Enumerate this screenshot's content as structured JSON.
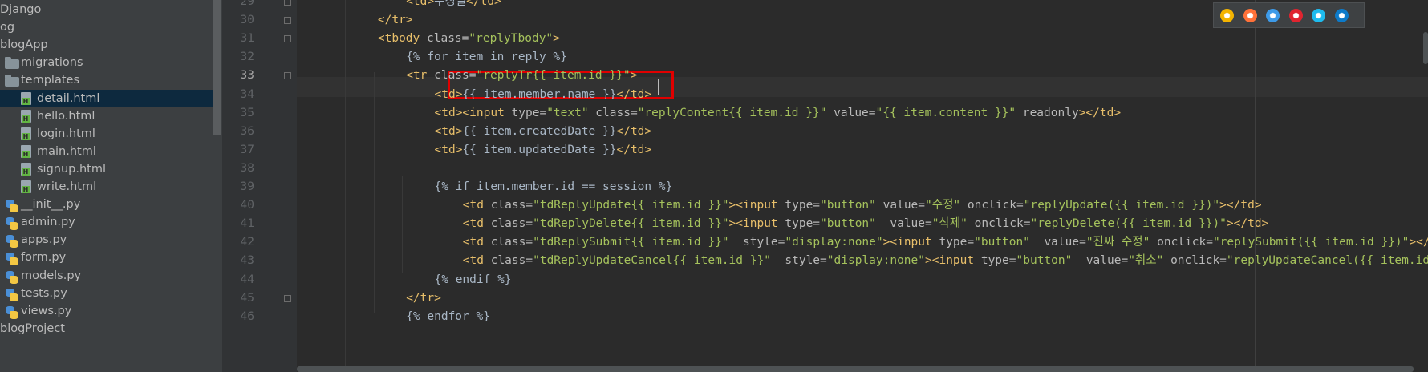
{
  "project_tree": {
    "items": [
      {
        "label": "Django",
        "icon": "folder-icon",
        "indent": 0
      },
      {
        "label": "og",
        "icon": "folder-icon",
        "indent": 0
      },
      {
        "label": "blogApp",
        "icon": "folder-icon",
        "indent": 0
      },
      {
        "label": "migrations",
        "icon": "folder-icon",
        "indent": 1
      },
      {
        "label": "templates",
        "icon": "folder-icon",
        "indent": 1
      },
      {
        "label": "detail.html",
        "icon": "html-file-icon",
        "indent": 2,
        "selected": true
      },
      {
        "label": "hello.html",
        "icon": "html-file-icon",
        "indent": 2
      },
      {
        "label": "login.html",
        "icon": "html-file-icon",
        "indent": 2
      },
      {
        "label": "main.html",
        "icon": "html-file-icon",
        "indent": 2
      },
      {
        "label": "signup.html",
        "icon": "html-file-icon",
        "indent": 2
      },
      {
        "label": "write.html",
        "icon": "html-file-icon",
        "indent": 2
      },
      {
        "label": "__init__.py",
        "icon": "python-file-icon",
        "indent": 1
      },
      {
        "label": "admin.py",
        "icon": "python-file-icon",
        "indent": 1
      },
      {
        "label": "apps.py",
        "icon": "python-file-icon",
        "indent": 1
      },
      {
        "label": "form.py",
        "icon": "python-file-icon",
        "indent": 1
      },
      {
        "label": "models.py",
        "icon": "python-file-icon",
        "indent": 1
      },
      {
        "label": "tests.py",
        "icon": "python-file-icon",
        "indent": 1
      },
      {
        "label": "views.py",
        "icon": "python-file-icon",
        "indent": 1
      },
      {
        "label": "blogProject",
        "icon": "folder-icon",
        "indent": 0
      }
    ]
  },
  "editor": {
    "current_line": "33",
    "lines": [
      {
        "no": "29",
        "indent": 4,
        "fold": true,
        "tokens": [
          [
            "t",
            "<td>"
          ],
          [
            "tp",
            "수정일"
          ],
          [
            "t",
            "</td>"
          ]
        ]
      },
      {
        "no": "30",
        "indent": 3,
        "fold": true,
        "tokens": [
          [
            "t",
            "</tr>"
          ]
        ]
      },
      {
        "no": "31",
        "indent": 3,
        "fold": true,
        "tokens": [
          [
            "t",
            "<tbody "
          ],
          [
            "a",
            "class="
          ],
          [
            "s",
            "\"replyTbody\""
          ],
          [
            "t",
            ">"
          ]
        ]
      },
      {
        "no": "32",
        "indent": 4,
        "fold": false,
        "tokens": [
          [
            "tp",
            "{% for item in reply %}"
          ]
        ]
      },
      {
        "no": "33",
        "indent": 4,
        "fold": true,
        "tokens": [
          [
            "t",
            "<tr "
          ],
          [
            "a",
            "class="
          ],
          [
            "s",
            "\"replyTr{{ item.id }}\""
          ],
          [
            "t",
            ">"
          ]
        ]
      },
      {
        "no": "34",
        "indent": 5,
        "fold": false,
        "tokens": [
          [
            "t",
            "<td>"
          ],
          [
            "tp",
            "{{ item.member.name }}"
          ],
          [
            "t",
            "</td>"
          ]
        ]
      },
      {
        "no": "35",
        "indent": 5,
        "fold": false,
        "tokens": [
          [
            "t",
            "<td><input "
          ],
          [
            "a",
            "type="
          ],
          [
            "s",
            "\"text\" "
          ],
          [
            "a",
            "class="
          ],
          [
            "s",
            "\"replyContent{{ item.id }}\" "
          ],
          [
            "a",
            "value="
          ],
          [
            "s",
            "\"{{ item.content }}\" "
          ],
          [
            "a",
            "readonly"
          ],
          [
            "t",
            "></td>"
          ]
        ]
      },
      {
        "no": "36",
        "indent": 5,
        "fold": false,
        "tokens": [
          [
            "t",
            "<td>"
          ],
          [
            "tp",
            "{{ item.createdDate }}"
          ],
          [
            "t",
            "</td>"
          ]
        ]
      },
      {
        "no": "37",
        "indent": 5,
        "fold": false,
        "tokens": [
          [
            "t",
            "<td>"
          ],
          [
            "tp",
            "{{ item.updatedDate }}"
          ],
          [
            "t",
            "</td>"
          ]
        ]
      },
      {
        "no": "38",
        "indent": 0,
        "fold": false,
        "tokens": []
      },
      {
        "no": "39",
        "indent": 5,
        "fold": false,
        "tokens": [
          [
            "tp",
            "{% if item.member.id == session %}"
          ]
        ]
      },
      {
        "no": "40",
        "indent": 6,
        "fold": false,
        "tokens": [
          [
            "t",
            "<td "
          ],
          [
            "a",
            "class="
          ],
          [
            "s",
            "\"tdReplyUpdate{{ item.id }}\""
          ],
          [
            "t",
            "><input "
          ],
          [
            "a",
            "type="
          ],
          [
            "s",
            "\"button\" "
          ],
          [
            "a",
            "value="
          ],
          [
            "s",
            "\"수정\" "
          ],
          [
            "a",
            "onclick="
          ],
          [
            "s",
            "\"replyUpdate({{ item.id }})\""
          ],
          [
            "t",
            "></td>"
          ]
        ]
      },
      {
        "no": "41",
        "indent": 6,
        "fold": false,
        "tokens": [
          [
            "t",
            "<td "
          ],
          [
            "a",
            "class="
          ],
          [
            "s",
            "\"tdReplyDelete{{ item.id }}\""
          ],
          [
            "t",
            "><input "
          ],
          [
            "a",
            "type="
          ],
          [
            "s",
            "\"button\"  "
          ],
          [
            "a",
            "value="
          ],
          [
            "s",
            "\"삭제\" "
          ],
          [
            "a",
            "onclick="
          ],
          [
            "s",
            "\"replyDelete({{ item.id }})\""
          ],
          [
            "t",
            "></td>"
          ]
        ]
      },
      {
        "no": "42",
        "indent": 6,
        "fold": false,
        "tokens": [
          [
            "t",
            "<td "
          ],
          [
            "a",
            "class="
          ],
          [
            "s",
            "\"tdReplySubmit{{ item.id }}\"  "
          ],
          [
            "a",
            "style="
          ],
          [
            "s",
            "\"display:none\""
          ],
          [
            "t",
            "><input "
          ],
          [
            "a",
            "type="
          ],
          [
            "s",
            "\"button\"  "
          ],
          [
            "a",
            "value="
          ],
          [
            "s",
            "\"진짜 수정\" "
          ],
          [
            "a",
            "onclick="
          ],
          [
            "s",
            "\"replySubmit({{ item.id }})\""
          ],
          [
            "t",
            "></td>"
          ]
        ]
      },
      {
        "no": "43",
        "indent": 6,
        "fold": false,
        "tokens": [
          [
            "t",
            "<td "
          ],
          [
            "a",
            "class="
          ],
          [
            "s",
            "\"tdReplyUpdateCancel{{ item.id }}\"  "
          ],
          [
            "a",
            "style="
          ],
          [
            "s",
            "\"display:none\""
          ],
          [
            "t",
            "><input "
          ],
          [
            "a",
            "type="
          ],
          [
            "s",
            "\"button\"  "
          ],
          [
            "a",
            "value="
          ],
          [
            "s",
            "\"취소\" "
          ],
          [
            "a",
            "onclick="
          ],
          [
            "s",
            "\"replyUpdateCancel({{ item.id }})\""
          ],
          [
            "t",
            "></td>"
          ]
        ]
      },
      {
        "no": "44",
        "indent": 5,
        "fold": false,
        "tokens": [
          [
            "tp",
            "{% endif %}"
          ]
        ]
      },
      {
        "no": "45",
        "indent": 4,
        "fold": true,
        "tokens": [
          [
            "t",
            "</tr>"
          ]
        ]
      },
      {
        "no": "46",
        "indent": 4,
        "fold": false,
        "tokens": [
          [
            "tp",
            "{% endfor %}"
          ]
        ]
      }
    ]
  },
  "browser_icons": [
    {
      "name": "chrome-icon",
      "color": "#f4b400"
    },
    {
      "name": "firefox-icon",
      "color": "#ff7139"
    },
    {
      "name": "safari-icon",
      "color": "#3d9ae8"
    },
    {
      "name": "opera-icon",
      "color": "#e0242f"
    },
    {
      "name": "internet-explorer-icon",
      "color": "#1ebbee"
    },
    {
      "name": "edge-icon",
      "color": "#0c7ac9"
    }
  ]
}
